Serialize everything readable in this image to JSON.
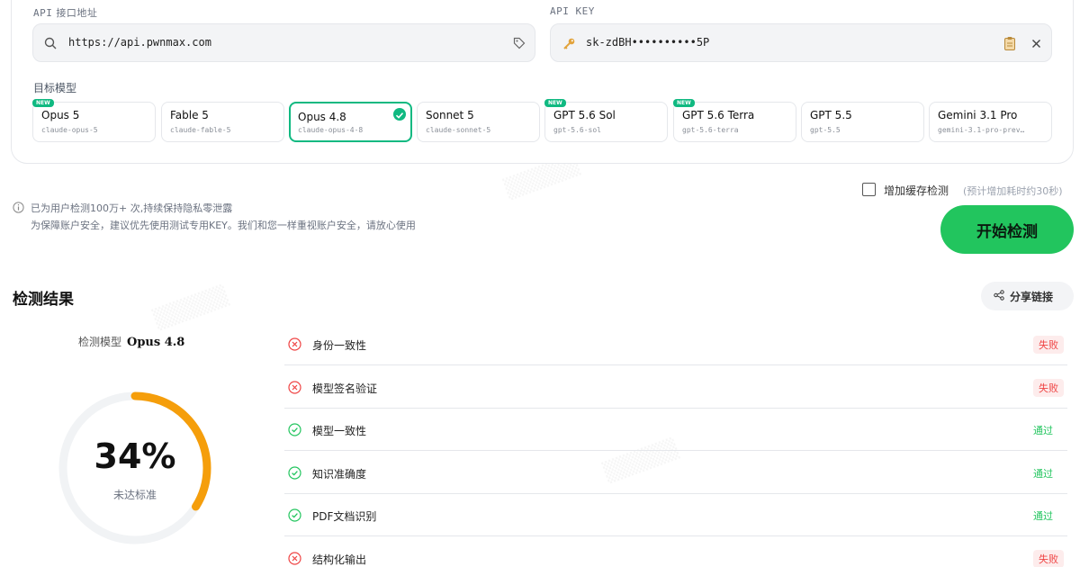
{
  "config": {
    "api_url_label_prefix": "API",
    "api_url_label": "接口地址",
    "api_url_value": "https://api.pwnmax.com",
    "api_key_label": "API KEY",
    "api_key_value": "sk-zdBH••••••••••5P",
    "target_model_label": "目标模型"
  },
  "models": [
    {
      "name": "Opus 5",
      "id": "claude-opus-5",
      "new_badge": "NEW"
    },
    {
      "name": "Fable 5",
      "id": "claude-fable-5"
    },
    {
      "name": "Opus 4.8",
      "id": "claude-opus-4-8"
    },
    {
      "name": "Sonnet 5",
      "id": "claude-sonnet-5"
    },
    {
      "name": "GPT 5.6 Sol",
      "id": "gpt-5.6-sol",
      "new_badge": "NEW"
    },
    {
      "name": "GPT 5.6 Terra",
      "id": "gpt-5.6-terra",
      "new_badge": "NEW"
    },
    {
      "name": "GPT 5.5",
      "id": "gpt-5.5"
    },
    {
      "name": "Gemini 3.1 Pro",
      "id": "gemini-3.1-pro-prev…"
    }
  ],
  "selected_model": "Opus 4.8",
  "notice": {
    "line1": "已为用户检测100万+ 次,持续保持隐私零泄露",
    "line2": "为保障账户安全，建议优先使用测试专用KEY。我们和您一样重视账户安全，请放心使用"
  },
  "cache_option": {
    "label": "增加缓存检测",
    "hint": "(预计增加耗时约30秒)",
    "checked": false
  },
  "start_button": "开始检测",
  "results": {
    "title": "检测结果",
    "share_label": "分享链接",
    "model_label": "检测模型",
    "model_value": "Opus 4.8",
    "score_text": "34%",
    "score_fraction": 0.34,
    "score_status": "未达标准",
    "colors": {
      "accent": "#22c55e",
      "gauge": "#f59e0b",
      "fail": "#ef4444"
    },
    "checks": [
      {
        "label": "身份一致性",
        "status": "失败",
        "pass": false
      },
      {
        "label": "模型签名验证",
        "status": "失败",
        "pass": false
      },
      {
        "label": "模型一致性",
        "status": "通过",
        "pass": true
      },
      {
        "label": "知识准确度",
        "status": "通过",
        "pass": true
      },
      {
        "label": "PDF文档识别",
        "status": "通过",
        "pass": true
      },
      {
        "label": "结构化输出",
        "status": "失败",
        "pass": false
      }
    ]
  }
}
